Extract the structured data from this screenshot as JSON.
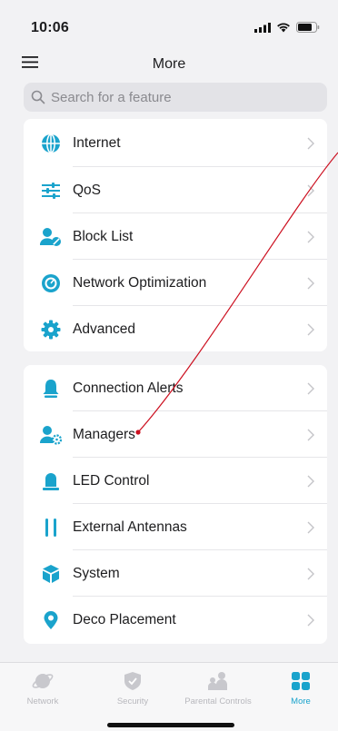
{
  "status_bar": {
    "time": "10:06"
  },
  "nav": {
    "title": "More",
    "menu_icon": "hamburger-menu-icon"
  },
  "search": {
    "placeholder": "Search for a feature",
    "value": ""
  },
  "colors": {
    "accent": "#1aa3cc",
    "background": "#f2f2f4",
    "card": "#ffffff",
    "annotation": "#cc1020"
  },
  "group1": [
    {
      "label": "Internet",
      "icon": "globe-icon"
    },
    {
      "label": "QoS",
      "icon": "sliders-icon"
    },
    {
      "label": "Block List",
      "icon": "user-block-icon"
    },
    {
      "label": "Network Optimization",
      "icon": "optimization-icon"
    },
    {
      "label": "Advanced",
      "icon": "gear-icon"
    }
  ],
  "group2": [
    {
      "label": "Connection Alerts",
      "icon": "bell-icon"
    },
    {
      "label": "Managers",
      "icon": "user-gear-icon"
    },
    {
      "label": "LED Control",
      "icon": "led-lamp-icon"
    },
    {
      "label": "External Antennas",
      "icon": "antennas-icon"
    },
    {
      "label": "System",
      "icon": "cube-icon"
    },
    {
      "label": "Deco Placement",
      "icon": "location-pin-icon"
    }
  ],
  "tabs": [
    {
      "label": "Network",
      "icon": "planet-icon",
      "active": false
    },
    {
      "label": "Security",
      "icon": "shield-check-icon",
      "active": false
    },
    {
      "label": "Parental Controls",
      "icon": "family-icon",
      "active": false
    },
    {
      "label": "More",
      "icon": "grid-icon",
      "active": true
    }
  ]
}
